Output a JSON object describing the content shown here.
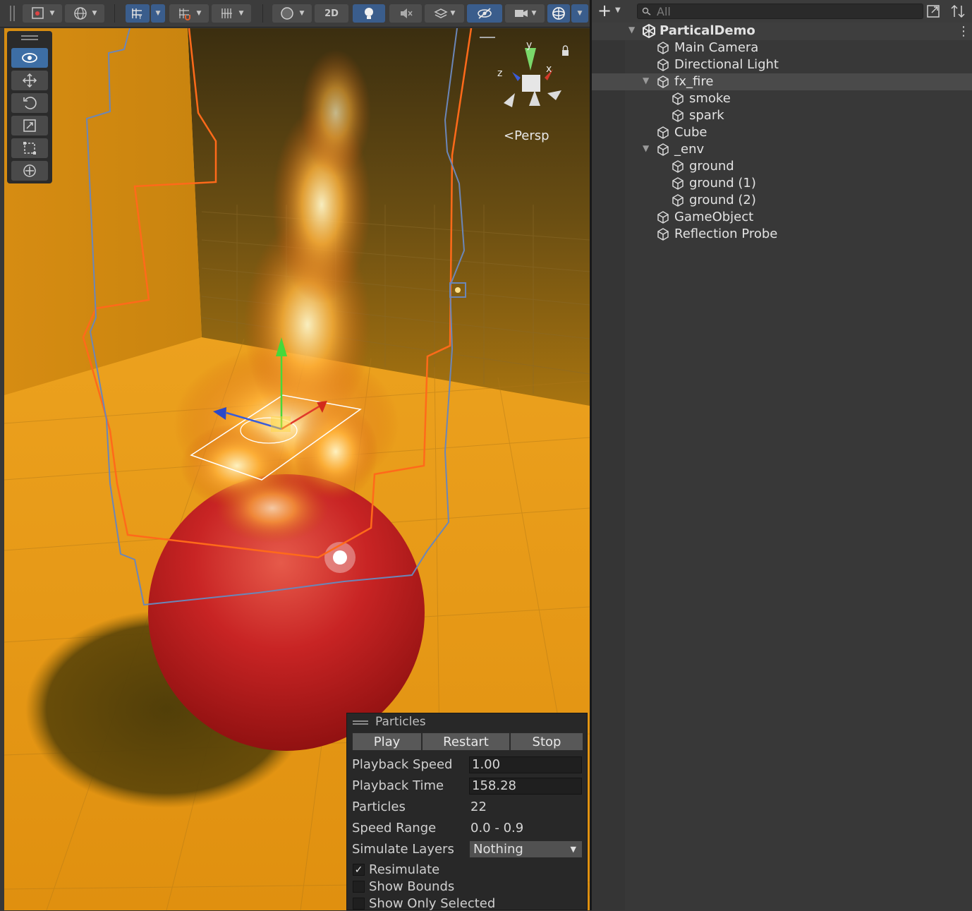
{
  "scene_toolbar": {
    "btn_2d": "2D"
  },
  "scene": {
    "projection_label": "Persp",
    "gizmo_axes": {
      "y": "y",
      "x": "x",
      "z": "z"
    }
  },
  "tools": [
    {
      "name": "view-tool",
      "icon": "eye-icon"
    },
    {
      "name": "move-tool",
      "icon": "move-icon"
    },
    {
      "name": "rotate-tool",
      "icon": "rotate-icon"
    },
    {
      "name": "scale-tool",
      "icon": "scale-icon"
    },
    {
      "name": "rect-tool",
      "icon": "rect-icon"
    },
    {
      "name": "transform-tool",
      "icon": "transform-icon"
    }
  ],
  "particles_panel": {
    "title": "Particles",
    "buttons": {
      "play": "Play",
      "restart": "Restart",
      "stop": "Stop"
    },
    "playback_speed_label": "Playback Speed",
    "playback_speed_value": "1.00",
    "playback_time_label": "Playback Time",
    "playback_time_value": "158.28",
    "particles_label": "Particles",
    "particles_value": "22",
    "speed_range_label": "Speed Range",
    "speed_range_value": "0.0 - 0.9",
    "simulate_layers_label": "Simulate Layers",
    "simulate_layers_value": "Nothing",
    "resimulate_label": "Resimulate",
    "resimulate_checked": true,
    "show_bounds_label": "Show Bounds",
    "show_bounds_checked": false,
    "show_only_selected_label": "Show Only Selected",
    "show_only_selected_checked": false
  },
  "hierarchy": {
    "search_placeholder": "All",
    "scene_name": "ParticalDemo",
    "items": [
      {
        "label": "Main Camera"
      },
      {
        "label": "Directional Light"
      },
      {
        "label": "fx_fire"
      },
      {
        "label": "smoke"
      },
      {
        "label": "spark"
      },
      {
        "label": "Cube"
      },
      {
        "label": "_env"
      },
      {
        "label": "ground"
      },
      {
        "label": "ground (1)"
      },
      {
        "label": "ground (2)"
      },
      {
        "label": "GameObject"
      },
      {
        "label": "Reflection Probe"
      }
    ]
  },
  "colors": {
    "accent": "#3a5d8c",
    "selection_orange": "#ff6a1a",
    "bounds_blue": "#6b86b8",
    "floor": "#e79a1f",
    "sphere": "#c41c1c"
  }
}
